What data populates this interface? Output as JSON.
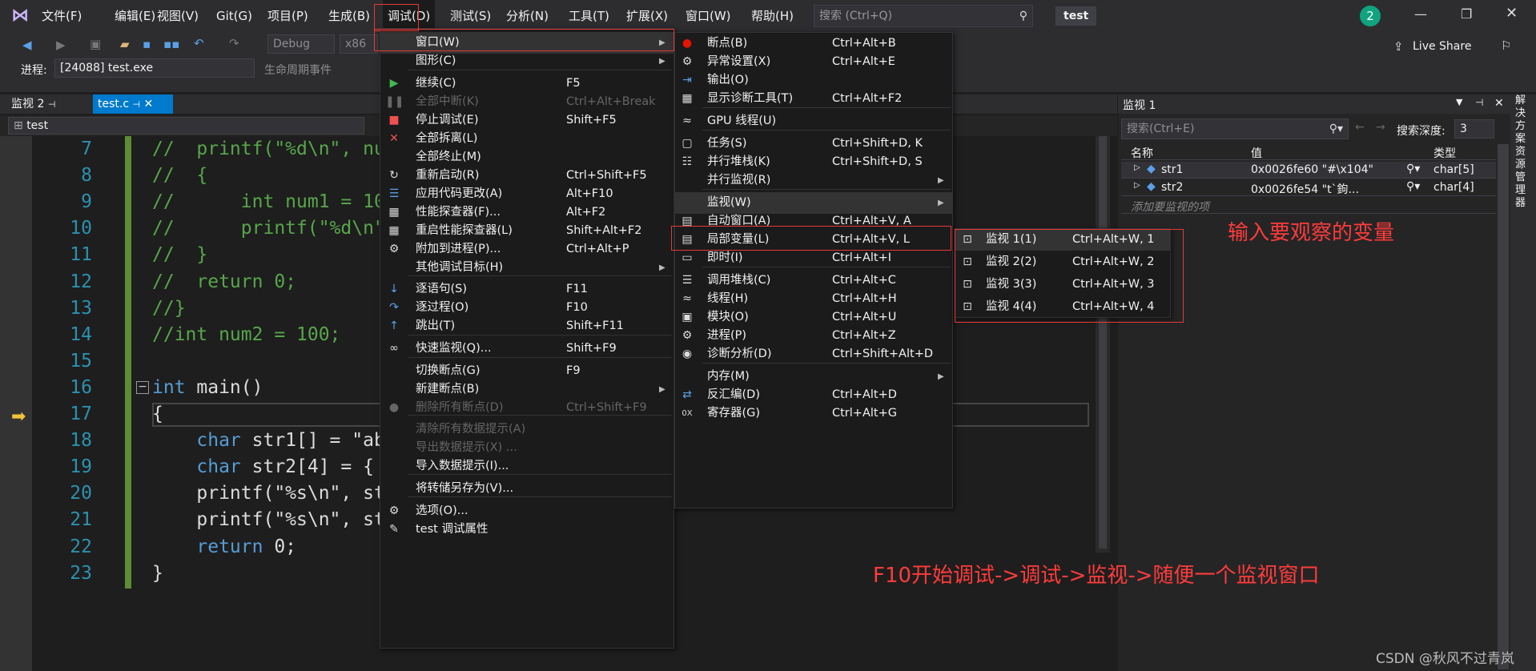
{
  "menubar": {
    "items": [
      "文件(F)",
      "编辑(E)",
      "视图(V)",
      "Git(G)",
      "项目(P)",
      "生成(B)",
      "调试(D)",
      "测试(S)",
      "分析(N)",
      "工具(T)",
      "扩展(X)",
      "窗口(W)",
      "帮助(H)"
    ],
    "search_placeholder": "搜索 (Ctrl+Q)",
    "project": "test",
    "notifications": "2",
    "live_share": "Live Share"
  },
  "toolbar": {
    "config": "Debug",
    "platform": "x86",
    "process_label": "进程:",
    "process_value": "[24088] test.exe",
    "lifecycle": "生命周期事件"
  },
  "tabs": {
    "watch2": "监视 2",
    "file": "test.c"
  },
  "nav": {
    "scope": "test"
  },
  "code": {
    "line_numbers": [
      "7",
      "8",
      "9",
      "10",
      "11",
      "12",
      "13",
      "14",
      "15",
      "16",
      "17",
      "18",
      "19",
      "20",
      "21",
      "22",
      "23"
    ],
    "lines": [
      "//  printf(\"%d\\n\", nu",
      "//  {",
      "//      int num1 = 10",
      "//      printf(\"%d\\n\"",
      "//  }",
      "//  return 0;",
      "//}",
      "//int num2 = 100;",
      "",
      "int main()",
      "{",
      "    char str1[] = \"ab",
      "    char str2[4] = {",
      "    printf(\"%s\\n\", st",
      "    printf(\"%s\\n\", st",
      "    return 0;",
      "}"
    ]
  },
  "debug_menu": [
    {
      "label": "窗口(W)",
      "shortcut": "",
      "submenu": true
    },
    {
      "label": "图形(C)",
      "shortcut": "",
      "submenu": true
    },
    {
      "label": "继续(C)",
      "shortcut": "F5"
    },
    {
      "label": "全部中断(K)",
      "shortcut": "Ctrl+Alt+Break",
      "disabled": true
    },
    {
      "label": "停止调试(E)",
      "shortcut": "Shift+F5"
    },
    {
      "label": "全部拆离(L)",
      "shortcut": ""
    },
    {
      "label": "全部终止(M)",
      "shortcut": ""
    },
    {
      "label": "重新启动(R)",
      "shortcut": "Ctrl+Shift+F5"
    },
    {
      "label": "应用代码更改(A)",
      "shortcut": "Alt+F10"
    },
    {
      "label": "性能探查器(F)...",
      "shortcut": "Alt+F2"
    },
    {
      "label": "重启性能探查器(L)",
      "shortcut": "Shift+Alt+F2"
    },
    {
      "label": "附加到进程(P)...",
      "shortcut": "Ctrl+Alt+P"
    },
    {
      "label": "其他调试目标(H)",
      "shortcut": "",
      "submenu": true
    },
    {
      "label": "逐语句(S)",
      "shortcut": "F11"
    },
    {
      "label": "逐过程(O)",
      "shortcut": "F10"
    },
    {
      "label": "跳出(T)",
      "shortcut": "Shift+F11"
    },
    {
      "label": "快速监视(Q)...",
      "shortcut": "Shift+F9"
    },
    {
      "label": "切换断点(G)",
      "shortcut": "F9"
    },
    {
      "label": "新建断点(B)",
      "shortcut": "",
      "submenu": true
    },
    {
      "label": "删除所有断点(D)",
      "shortcut": "Ctrl+Shift+F9",
      "disabled": true
    },
    {
      "label": "清除所有数据提示(A)",
      "shortcut": "",
      "disabled": true
    },
    {
      "label": "导出数据提示(X) ...",
      "shortcut": "",
      "disabled": true
    },
    {
      "label": "导入数据提示(I)...",
      "shortcut": ""
    },
    {
      "label": "将转储另存为(V)...",
      "shortcut": ""
    },
    {
      "label": "选项(O)...",
      "shortcut": ""
    },
    {
      "label": "test 调试属性",
      "shortcut": ""
    }
  ],
  "window_menu": [
    {
      "label": "断点(B)",
      "shortcut": "Ctrl+Alt+B"
    },
    {
      "label": "异常设置(X)",
      "shortcut": "Ctrl+Alt+E"
    },
    {
      "label": "输出(O)",
      "shortcut": ""
    },
    {
      "label": "显示诊断工具(T)",
      "shortcut": "Ctrl+Alt+F2"
    },
    {
      "label": "GPU 线程(U)",
      "shortcut": ""
    },
    {
      "label": "任务(S)",
      "shortcut": "Ctrl+Shift+D, K"
    },
    {
      "label": "并行堆栈(K)",
      "shortcut": "Ctrl+Shift+D, S"
    },
    {
      "label": "并行监视(R)",
      "shortcut": "",
      "submenu": true
    },
    {
      "label": "监视(W)",
      "shortcut": "",
      "submenu": true
    },
    {
      "label": "自动窗口(A)",
      "shortcut": "Ctrl+Alt+V, A"
    },
    {
      "label": "局部变量(L)",
      "shortcut": "Ctrl+Alt+V, L"
    },
    {
      "label": "即时(I)",
      "shortcut": "Ctrl+Alt+I"
    },
    {
      "label": "调用堆栈(C)",
      "shortcut": "Ctrl+Alt+C"
    },
    {
      "label": "线程(H)",
      "shortcut": "Ctrl+Alt+H"
    },
    {
      "label": "模块(O)",
      "shortcut": "Ctrl+Alt+U"
    },
    {
      "label": "进程(P)",
      "shortcut": "Ctrl+Alt+Z"
    },
    {
      "label": "诊断分析(D)",
      "shortcut": "Ctrl+Shift+Alt+D"
    },
    {
      "label": "内存(M)",
      "shortcut": "",
      "submenu": true
    },
    {
      "label": "反汇编(D)",
      "shortcut": "Ctrl+Alt+D"
    },
    {
      "label": "寄存器(G)",
      "shortcut": "Ctrl+Alt+G"
    }
  ],
  "watch_menu": [
    {
      "label": "监视 1(1)",
      "shortcut": "Ctrl+Alt+W, 1"
    },
    {
      "label": "监视 2(2)",
      "shortcut": "Ctrl+Alt+W, 2"
    },
    {
      "label": "监视 3(3)",
      "shortcut": "Ctrl+Alt+W, 3"
    },
    {
      "label": "监视 4(4)",
      "shortcut": "Ctrl+Alt+W, 4"
    }
  ],
  "watch_panel": {
    "title": "监视 1",
    "search_placeholder": "搜索(Ctrl+E)",
    "depth_label": "搜索深度:",
    "depth_value": "3",
    "columns": [
      "名称",
      "值",
      "类型"
    ],
    "rows": [
      {
        "name": "str1",
        "value": "0x0026fe60 \"#\\x104\"",
        "type": "char[5]"
      },
      {
        "name": "str2",
        "value": "0x0026fe54 \"t`鉤...",
        "type": "char[4]"
      }
    ],
    "add_placeholder": "添加要监视的项"
  },
  "side_panel": "解决方案资源管理器",
  "annotations": {
    "watch_hint": "输入要观察的变量",
    "steps": "F10开始调试->调试->监视->随便一个监视窗口",
    "watermark": "CSDN @秋风不过青岚"
  }
}
